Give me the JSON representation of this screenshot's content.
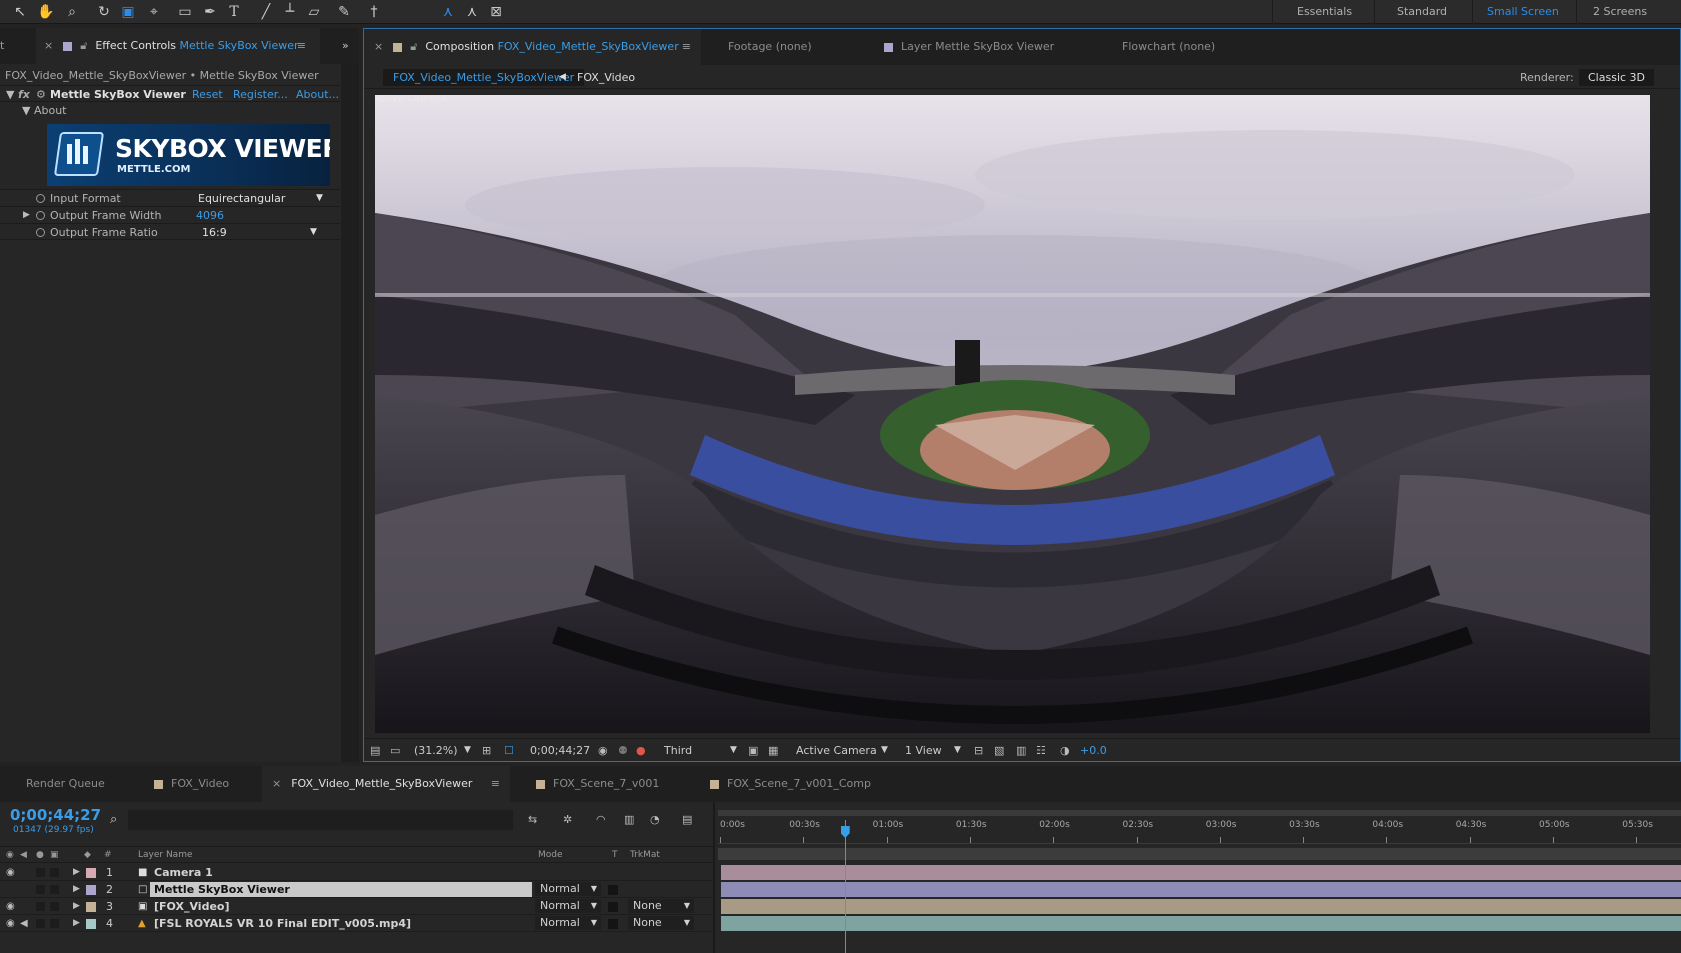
{
  "toolbar": {
    "tool_icons": [
      "selection-tool-icon",
      "hand-tool-icon",
      "zoom-tool-icon",
      "rotate-tool-icon",
      "camera-tool-icon",
      "pan-behind-tool-icon",
      "rectangle-tool-icon",
      "pen-tool-icon",
      "type-tool-icon",
      "brush-tool-icon",
      "clone-stamp-tool-icon",
      "eraser-tool-icon",
      "roto-brush-tool-icon",
      "puppet-pin-tool-icon",
      "local-axis-icon",
      "world-axis-icon",
      "view-axis-icon"
    ],
    "workspaces": [
      {
        "label": "Essentials",
        "active": false
      },
      {
        "label": "Standard",
        "active": false
      },
      {
        "label": "Small Screen",
        "active": true
      },
      {
        "label": "2 Screens",
        "active": false
      }
    ]
  },
  "effect_controls": {
    "tab_partial": "t",
    "tab_label": "Effect Controls",
    "tab_target": "Mettle SkyBox Viewer",
    "breadcrumb": "FOX_Video_Mettle_SkyBoxViewer • Mettle SkyBox Viewer",
    "fx_label": "fx",
    "effect_name": "Mettle SkyBox Viewer",
    "reset": "Reset",
    "register": "Register...",
    "about_link": "About...",
    "about_group": "About",
    "logo_title": "SKYBOX VIEWER",
    "logo_sub": "METTLE.COM",
    "params": [
      {
        "label": "Input Format",
        "value": "Equirectangular",
        "type": "dropdown"
      },
      {
        "label": "Output Frame Width",
        "value": "4096",
        "type": "number"
      },
      {
        "label": "Output Frame Ratio",
        "value": "16:9",
        "type": "dropdown"
      }
    ]
  },
  "viewer": {
    "tabs": [
      {
        "label": "Composition",
        "target": "FOX_Video_Mettle_SkyBoxViewer",
        "active": true
      },
      {
        "label": "Footage (none)",
        "active": false
      },
      {
        "label": "Layer Mettle SkyBox Viewer",
        "active": false
      },
      {
        "label": "Flowchart (none)",
        "active": false
      }
    ],
    "breadcrumbs": [
      "FOX_Video_Mettle_SkyBoxViewer",
      "FOX_Video"
    ],
    "renderer_label": "Renderer:",
    "renderer_value": "Classic 3D",
    "overlay": "Active Camera",
    "footer": {
      "zoom": "(31.2%)",
      "timecode": "0;00;44;27",
      "resolution": "Third",
      "camera": "Active Camera",
      "views": "1 View",
      "exposure": "+0.0"
    }
  },
  "timeline": {
    "tabs": [
      {
        "label": "Render Queue"
      },
      {
        "label": "FOX_Video"
      },
      {
        "label": "FOX_Video_Mettle_SkyBoxViewer",
        "active": true
      },
      {
        "label": "FOX_Scene_7_v001"
      },
      {
        "label": "FOX_Scene_7_v001_Comp"
      }
    ],
    "timecode": "0;00;44;27",
    "frame_info": "01347 (29.97 fps)",
    "playhead_seconds": 44.9,
    "column_headers": {
      "num": "#",
      "layer_name": "Layer Name",
      "mode": "Mode",
      "t": "T",
      "trkmat": "TrkMat"
    },
    "ruler_ticks": [
      "0:00s",
      "00:30s",
      "01:00s",
      "01:30s",
      "02:00s",
      "02:30s",
      "03:00s",
      "03:30s",
      "04:00s",
      "04:30s",
      "05:00s",
      "05:30s"
    ],
    "layers": [
      {
        "num": "1",
        "name": "Camera 1",
        "color": "#d7a9b4",
        "icon": "camera-layer-icon",
        "mode": "",
        "trkmat": "",
        "bar_color": "#a98d9a",
        "selected": false
      },
      {
        "num": "2",
        "name": "Mettle SkyBox Viewer",
        "color": "#aaa6cc",
        "icon": "solid-layer-icon",
        "mode": "Normal",
        "trkmat": "",
        "bar_color": "#8e8bb7",
        "selected": true
      },
      {
        "num": "3",
        "name": "[FOX_Video]",
        "color": "#c4b196",
        "icon": "comp-layer-icon",
        "mode": "Normal",
        "trkmat": "None",
        "bar_color": "#a89b85",
        "selected": false
      },
      {
        "num": "4",
        "name": "[FSL ROYALS VR 10 Final EDIT_v005.mp4]",
        "color": "#a6c9c8",
        "icon": "footage-layer-icon",
        "mode": "Normal",
        "trkmat": "None",
        "bar_color": "#7fa3a0",
        "selected": false
      }
    ]
  }
}
